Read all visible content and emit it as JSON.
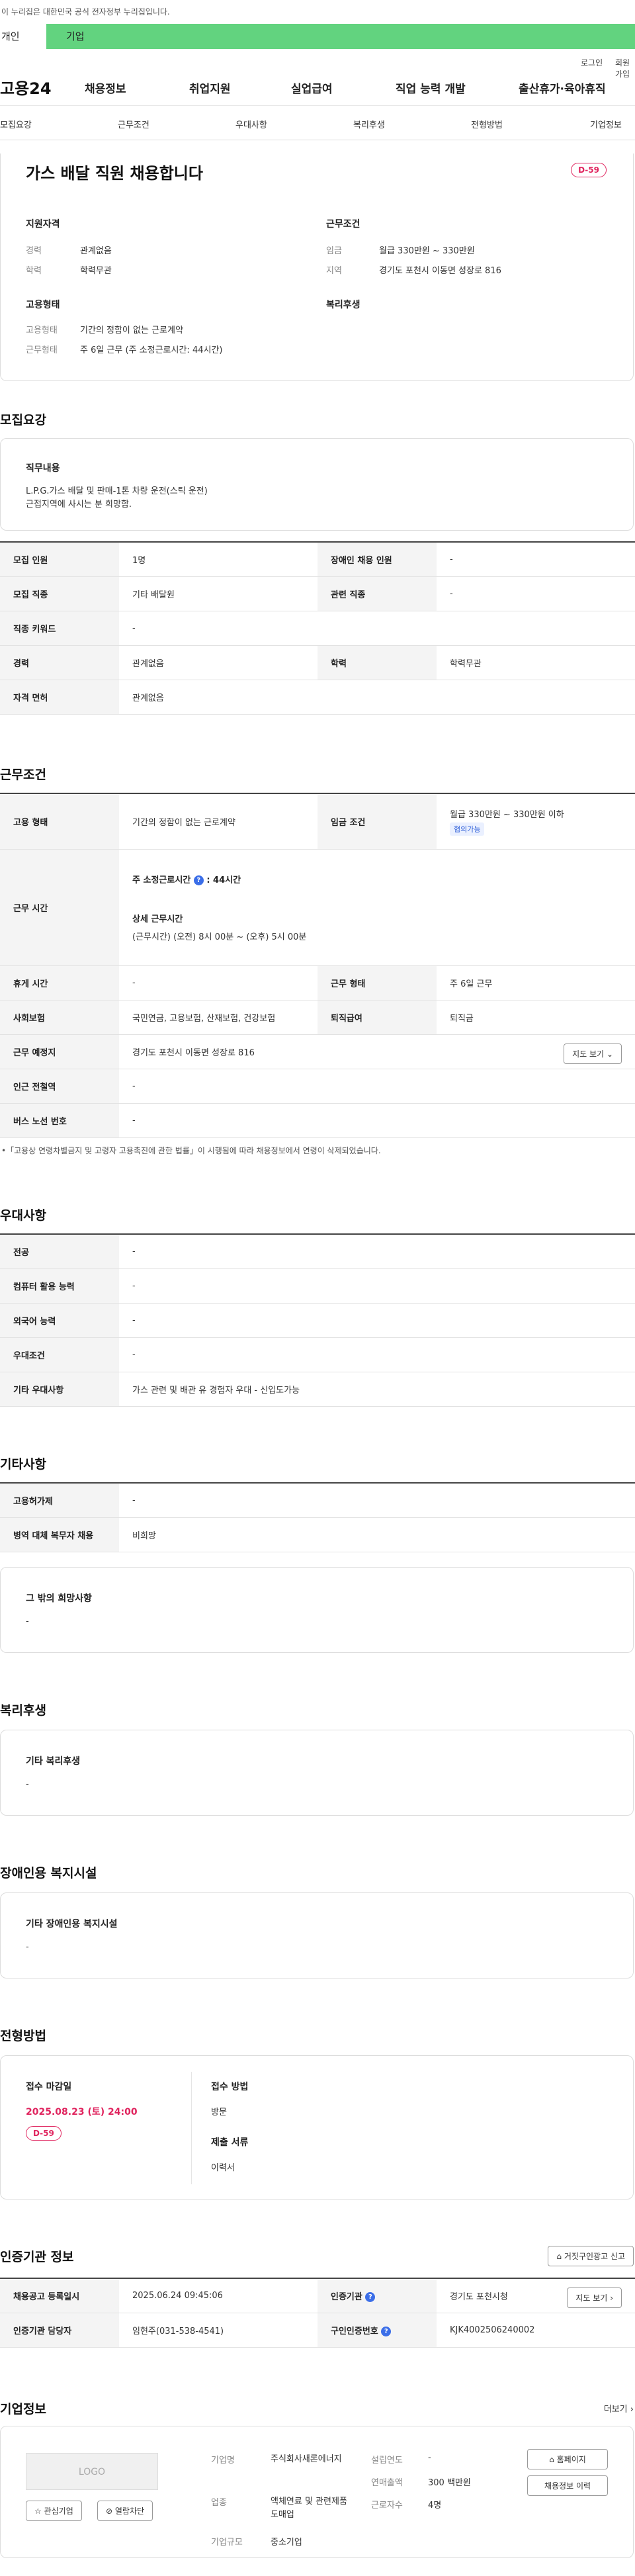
{
  "banner": {
    "text": "이 누리집은 대한민국 공식 전자정부 누리집입니다."
  },
  "type_tabs": {
    "personal": "개인",
    "company": "기업"
  },
  "util": {
    "login": "로그인",
    "join": "회원가입"
  },
  "gnb": {
    "logo": "고용24",
    "menus": [
      "채용정보",
      "취업지원",
      "실업급여",
      "직업 능력 개발",
      "출산휴가·육아휴직"
    ]
  },
  "anchor_nav": [
    "모집요강",
    "근무조건",
    "우대사항",
    "복리후생",
    "전형방법",
    "기업정보"
  ],
  "job": {
    "title": "가스 배달 직원 채용합니다",
    "dday": "D-59",
    "qual_title": "지원자격",
    "career_label": "경력",
    "career_value": "관계없음",
    "edu_label": "학력",
    "edu_value": "학력무관",
    "cond_title": "근무조건",
    "wage_label": "임금",
    "wage_value": "월급 330만원 ~ 330만원",
    "region_label": "지역",
    "region_value": "경기도 포천시 이동면 성장로 816",
    "emp_title": "고용형태",
    "emptype_label": "고용형태",
    "emptype_value": "기간의 정함이 없는 근로계약",
    "worktype_label": "근무형태",
    "worktype_value": "주 6일 근무 (주 소정근로시간: 44시간)",
    "welfare_title": "복리후생"
  },
  "recruit": {
    "section_title": "모집요강",
    "duty_title": "직무내용",
    "duty_text": "L.P.G.가스  배달 및 판매-1톤 차량 운전(스틱  운전)",
    "duty_text2": "근접지역에 사시는 분 희망함.",
    "rows": [
      [
        "모집 인원",
        "1명",
        "장애인 채용 인원",
        "-"
      ],
      [
        "모집 직종",
        "기타 배달원",
        "관련 직종",
        "-"
      ],
      [
        "직종 키워드",
        "-",
        "",
        ""
      ],
      [
        "경력",
        "관계없음",
        "학력",
        "학력무관"
      ],
      [
        "자격 면허",
        "관계없음",
        "",
        ""
      ]
    ]
  },
  "work": {
    "section_title": "근무조건",
    "emp_type_label": "고용 형태",
    "emp_type_value": "기간의 정함이 없는 근로계약",
    "wage_label": "임금 조건",
    "wage_value": "월급 330만원 ~ 330만원 이하",
    "wage_chip": "협의가능",
    "hours_label": "근무 시간",
    "hours_weekly_label": "주 소정근로시간",
    "hours_weekly_value": ": 44시간",
    "hours_detail_label": "상세 근무시간",
    "hours_detail_value": "(근무시간) (오전) 8시 00분 ~ (오후) 5시 00분",
    "rest_label": "휴게 시간",
    "rest_value": "-",
    "form_label": "근무 형태",
    "form_value": "주 6일 근무",
    "insurance_label": "사회보험",
    "insurance_value": "국민연금, 고용보험, 산재보험, 건강보험",
    "severance_label": "퇴직급여",
    "severance_value": "퇴직금",
    "place_label": "근무 예정지",
    "place_value": "경기도 포천시 이동면 성장로 816",
    "map_btn": "지도 보기",
    "subway_label": "인근 전철역",
    "subway_value": "-",
    "bus_label": "버스 노선 번호",
    "bus_value": "-",
    "note": "「고용상 연령차별금지 및 고령자 고용촉진에 관한 법률」이 시행됨에 따라 채용정보에서 연령이 삭제되었습니다."
  },
  "pref": {
    "section_title": "우대사항",
    "rows": [
      [
        "전공",
        "-"
      ],
      [
        "컴퓨터 활용 능력",
        "-"
      ],
      [
        "외국어 능력",
        "-"
      ],
      [
        "우대조건",
        "-"
      ],
      [
        "기타 우대사항",
        "가스 관련 및 배관 유 경험자 우대 - 신입도가능"
      ]
    ]
  },
  "etc": {
    "section_title": "기타사항",
    "rows": [
      [
        "고용허가제",
        "-"
      ],
      [
        "병역 대체 복무자 채용",
        "비희망"
      ]
    ],
    "other_title": "그 밖의 희망사항",
    "other_value": "-"
  },
  "welfare": {
    "section_title": "복리후생",
    "sub_title": "기타 복리후생",
    "value": "-"
  },
  "disabled": {
    "section_title": "장애인용 복지시설",
    "sub_title": "기타 장애인용 복지시설",
    "value": "-"
  },
  "process": {
    "section_title": "전형방법",
    "deadline_label": "접수 마감일",
    "deadline_value": "2025.08.23 (토) 24:00",
    "dday": "D-59",
    "method_label": "접수 방법",
    "method_value": "방문",
    "docs_label": "제출 서류",
    "docs_value": "이력서"
  },
  "agency": {
    "section_title": "인증기관 정보",
    "report_btn": "거짓구인광고 신고",
    "rows": [
      [
        "채용공고 등록일시",
        "2025.06.24 09:45:06",
        "인증기관",
        "경기도 포천시청"
      ],
      [
        "인증기관 담당자",
        "임현주(031-538-4541)",
        "구인인증번호",
        "KJK4002506240002"
      ]
    ],
    "map_btn": "지도 보기"
  },
  "company": {
    "section_title": "기업정보",
    "more": "더보기",
    "logo_text": "LOGO",
    "fav_btn": "관심기업",
    "block_btn": "열람차단",
    "name_label": "기업명",
    "name_value": "주식회사새론에너지",
    "industry_label": "업종",
    "industry_value": "액체연료 및 관련제품 도매업",
    "size_label": "기업규모",
    "size_value": "중소기업",
    "founded_label": "설립연도",
    "founded_value": "-",
    "sales_label": "연매출액",
    "sales_value": "300 백만원",
    "employees_label": "근로자수",
    "employees_value": "4명",
    "homepage_btn": "홈페이지",
    "jobs_btn": "채용정보 이력"
  }
}
